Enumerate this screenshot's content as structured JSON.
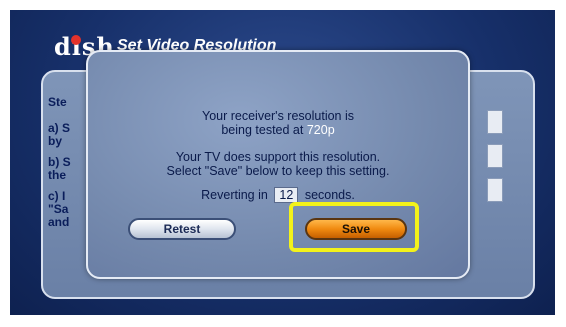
{
  "header": {
    "logo_text": "dish",
    "title": "Set Video Resolution"
  },
  "background_panel": {
    "lines": [
      "Ste",
      "a) S",
      "by",
      "b) S",
      "the",
      "c) I",
      "\"Sa",
      "and"
    ]
  },
  "dialog": {
    "line1": "Your receiver's resolution is",
    "line2_prefix": "being tested at",
    "resolution": "720p",
    "line3": "Your TV does support this resolution.",
    "line4": "Select \"Save\" below to keep this setting.",
    "revert_prefix": "Reverting in",
    "countdown": "12",
    "revert_suffix": "seconds."
  },
  "buttons": {
    "retest_label": "Retest",
    "save_label": "Save"
  },
  "colors": {
    "focus_ring": "#f3f21a",
    "save_button": "#f08a10",
    "logo_dot": "#e3322b"
  }
}
